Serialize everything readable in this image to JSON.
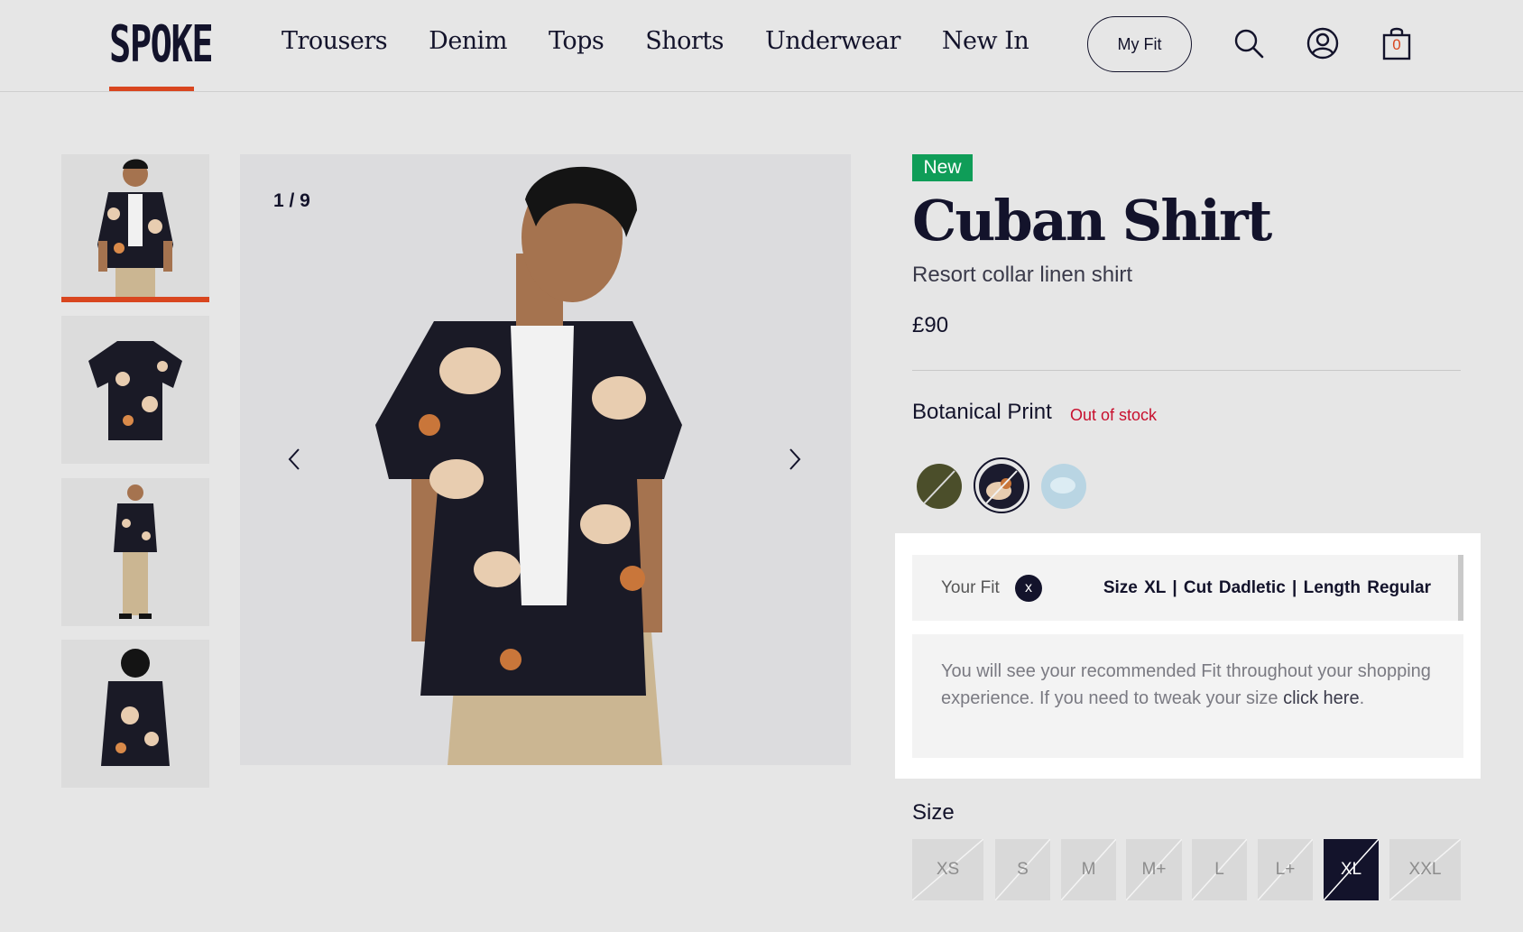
{
  "header": {
    "logo": "SPOKE",
    "nav": [
      "Trousers",
      "Denim",
      "Tops",
      "Shorts",
      "Underwear",
      "New In"
    ],
    "my_fit_label": "My Fit",
    "cart_count": "0",
    "icons": [
      "search-icon",
      "account-icon",
      "bag-icon"
    ]
  },
  "gallery": {
    "counter": "1 / 9",
    "thumbnails": [
      "front-view",
      "flat-lay",
      "full-length",
      "back-view"
    ]
  },
  "product": {
    "badge": "New",
    "title": "Cuban Shirt",
    "subtitle": "Resort collar linen shirt",
    "price": "£90",
    "colour_name": "Botanical Print",
    "stock_status": "Out of stock",
    "swatches": [
      {
        "name": "olive",
        "color": "#4b4e2a"
      },
      {
        "name": "botanical-print",
        "color": "#1b1b2e",
        "selected": true
      },
      {
        "name": "light-blue",
        "color": "#b9d5e3"
      }
    ]
  },
  "fit": {
    "label": "Your Fit",
    "close": "x",
    "summary": "Size XL  |  Cut Dadletic  |  Length Regular",
    "note": "You will see your recommended Fit throughout your shopping experience. If you need to tweak your size",
    "link": "click here",
    "link_suffix": "."
  },
  "sizes": {
    "label": "Size",
    "options": [
      "XS",
      "S",
      "M",
      "M+",
      "L",
      "L+",
      "XL",
      "XXL"
    ],
    "selected": "XL"
  },
  "colors": {
    "accent": "#d9461f",
    "ink": "#13132b",
    "new_badge": "#0f9d58",
    "out_of_stock": "#c8102e"
  }
}
